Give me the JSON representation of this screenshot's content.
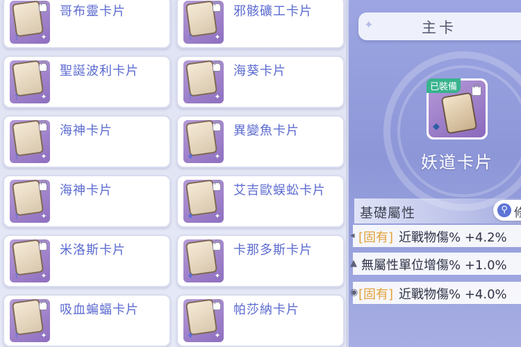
{
  "cards": [
    {
      "name": "哥布靈卡片",
      "type_icon": "sword-icon"
    },
    {
      "name": "邪骸礦工卡片",
      "type_icon": "sword-icon"
    },
    {
      "name": "聖誕波利卡片",
      "type_icon": "sword-icon"
    },
    {
      "name": "海葵卡片",
      "type_icon": "sword-icon"
    },
    {
      "name": "海神卡片",
      "type_icon": "sword-icon"
    },
    {
      "name": "異變魚卡片",
      "type_icon": "drop-icon"
    },
    {
      "name": "海神卡片",
      "type_icon": "sword-icon"
    },
    {
      "name": "艾吉歐蜈蚣卡片",
      "type_icon": "drop-icon"
    },
    {
      "name": "米洛斯卡片",
      "type_icon": "sword-icon"
    },
    {
      "name": "卡那多斯卡片",
      "type_icon": "drop-icon"
    },
    {
      "name": "吸血蝙蝠卡片",
      "type_icon": "sword-icon"
    },
    {
      "name": "帕莎納卡片",
      "type_icon": "drop-icon"
    }
  ],
  "detail": {
    "header_title": "主卡",
    "equipped_badge": "已裝備",
    "equipped_name": "妖道卡片",
    "attributes_title": "基礎屬性",
    "inspect_label": "修",
    "attributes": [
      {
        "tag": "[固有]",
        "text": "近戰物傷% +4.2%"
      },
      {
        "tag": "",
        "text": "無屬性單位增傷% +1.0%"
      },
      {
        "tag": "[固有]",
        "text": "近戰物傷% +4.0%"
      }
    ]
  },
  "colors": {
    "card_name": "#5c6bd0",
    "tag": "#e2a23a",
    "badge": "#38b38d",
    "detail_bg": "#9da6e2"
  }
}
